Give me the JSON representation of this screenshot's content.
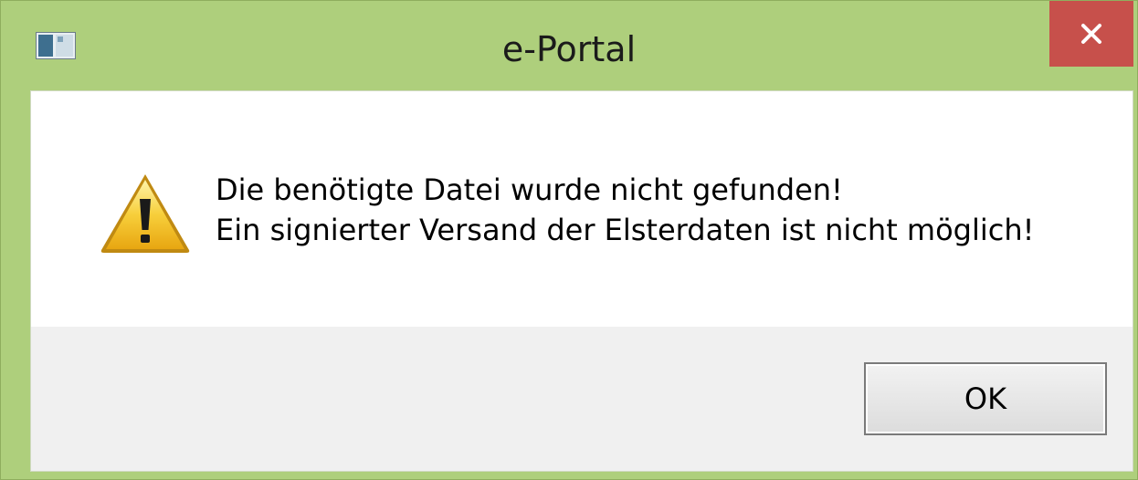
{
  "window": {
    "title": "e-Portal",
    "close_symbol": "✕"
  },
  "dialog": {
    "icon": "warning-icon",
    "message_line1": "Die benötigte Datei wurde nicht gefunden!",
    "message_line2": "Ein signierter Versand der Elsterdaten ist nicht möglich!"
  },
  "buttons": {
    "ok_label": "OK"
  },
  "colors": {
    "frame": "#aecf7c",
    "close_button": "#c7504b",
    "footer": "#f0f0f0",
    "content": "#ffffff"
  }
}
